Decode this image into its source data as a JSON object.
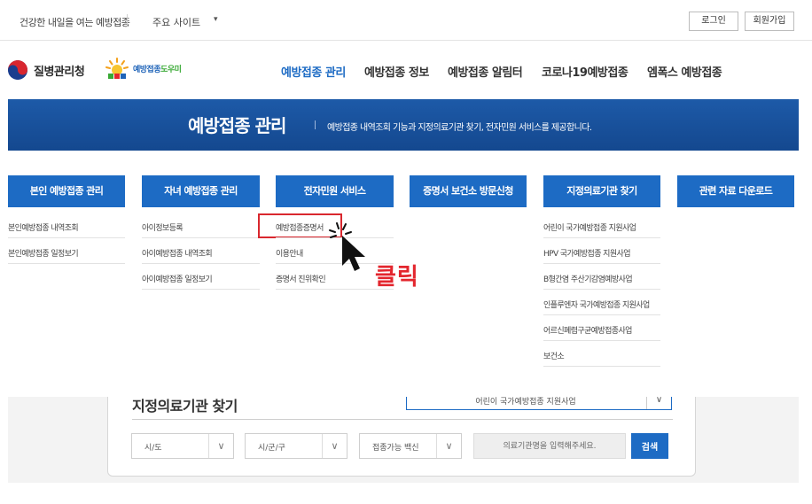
{
  "topbar": {
    "slogan": "건강한 내일을 여는 예방접종",
    "sites_label": "주요 사이트",
    "caret": "▾",
    "login": "로그인",
    "join": "회원가입"
  },
  "header": {
    "agency_name": "질병관리청",
    "helper_name_a": "예방접종",
    "helper_name_b": "도우미",
    "gnb": [
      "예방접종 관리",
      "예방접종 정보",
      "예방접종 알림터",
      "코로나19예방접종",
      "엠폭스 예방접종"
    ]
  },
  "banner": {
    "title": "예방접종 관리",
    "description": "예방접종 내역조회 기능과 지정의료기관 찾기, 전자민원 서비스를 제공합니다."
  },
  "menu": {
    "columns": [
      {
        "title": "본인 예방접종 관리",
        "items": [
          "본인예방접종 내역조회",
          "본인예방접종 일정보기"
        ]
      },
      {
        "title": "자녀 예방접종 관리",
        "items": [
          "아이정보등록",
          "아이예방접종 내역조회",
          "아이예방접종 일정보기"
        ]
      },
      {
        "title": "전자민원 서비스",
        "items": [
          "예방접종증명서",
          "이용안내",
          "증명서 진위확인"
        ]
      },
      {
        "title": "증명서 보건소 방문신청",
        "items": []
      },
      {
        "title": "지정의료기관 찾기",
        "items": [
          "어린이 국가예방접종 지원사업",
          "HPV 국가예방접종 지원사업",
          "B형간염 주산기감염예방사업",
          "인플루엔자 국가예방접종 지원사업",
          "어르신폐렴구균예방접종사업",
          "보건소"
        ]
      },
      {
        "title": "관련 자료 다운로드",
        "items": []
      }
    ]
  },
  "annotation": {
    "click_text": "클릭"
  },
  "search": {
    "title": "지정의료기관 찾기",
    "program_value": "어린이 국가예방접종 지원사업",
    "arrow": "∨",
    "sido": "시/도",
    "sigungu": "시/군/구",
    "vaccine": "접종가능 백신",
    "placeholder": "의료기관명을 입력해주세요.",
    "button": "검색"
  },
  "colors": {
    "primary": "#1d6bc4",
    "banner": "#14488f",
    "highlight": "#d9272e"
  }
}
